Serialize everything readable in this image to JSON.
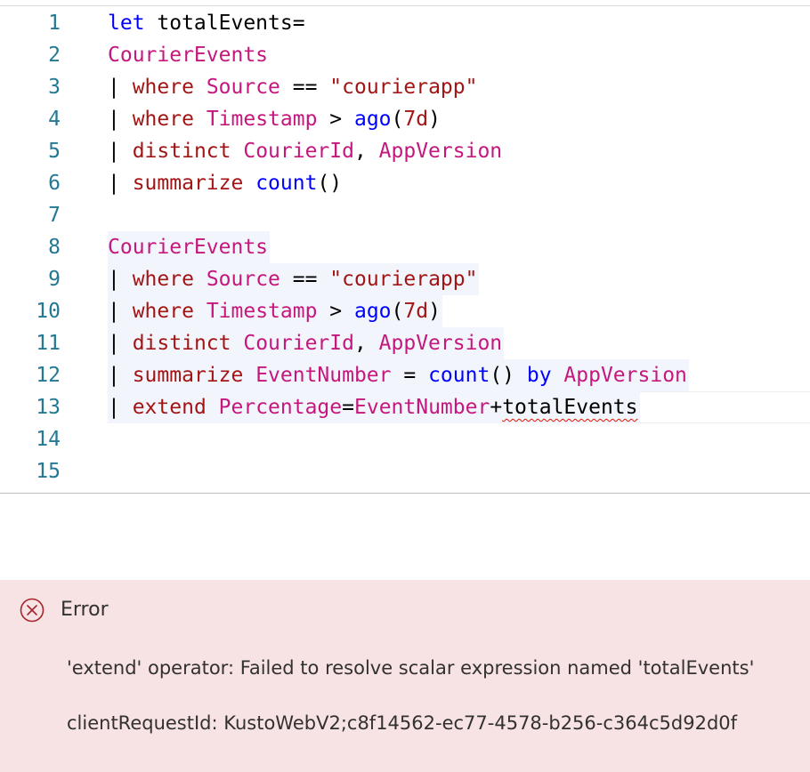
{
  "editor": {
    "lines": [
      {
        "num": "1",
        "tokens": [
          {
            "t": "let",
            "c": "kw"
          },
          {
            "t": " totalEvents=",
            "c": "pl"
          }
        ]
      },
      {
        "num": "2",
        "tokens": [
          {
            "t": "CourierEvents",
            "c": "tbl"
          }
        ]
      },
      {
        "num": "3",
        "tokens": [
          {
            "t": "| ",
            "c": "pl"
          },
          {
            "t": "where",
            "c": "op"
          },
          {
            "t": " ",
            "c": "pl"
          },
          {
            "t": "Source",
            "c": "col"
          },
          {
            "t": " == ",
            "c": "pl"
          },
          {
            "t": "\"courierapp\"",
            "c": "str"
          }
        ]
      },
      {
        "num": "4",
        "tokens": [
          {
            "t": "| ",
            "c": "pl"
          },
          {
            "t": "where",
            "c": "op"
          },
          {
            "t": " ",
            "c": "pl"
          },
          {
            "t": "Timestamp",
            "c": "col"
          },
          {
            "t": " > ",
            "c": "pl"
          },
          {
            "t": "ago",
            "c": "fn"
          },
          {
            "t": "(",
            "c": "pl"
          },
          {
            "t": "7d",
            "c": "op"
          },
          {
            "t": ")",
            "c": "pl"
          }
        ]
      },
      {
        "num": "5",
        "tokens": [
          {
            "t": "| ",
            "c": "pl"
          },
          {
            "t": "distinct",
            "c": "op"
          },
          {
            "t": " ",
            "c": "pl"
          },
          {
            "t": "CourierId",
            "c": "col"
          },
          {
            "t": ", ",
            "c": "pl"
          },
          {
            "t": "AppVersion",
            "c": "col"
          }
        ]
      },
      {
        "num": "6",
        "tokens": [
          {
            "t": "| ",
            "c": "pl"
          },
          {
            "t": "summarize",
            "c": "op"
          },
          {
            "t": " ",
            "c": "pl"
          },
          {
            "t": "count",
            "c": "fn"
          },
          {
            "t": "()",
            "c": "pl"
          }
        ]
      },
      {
        "num": "7",
        "tokens": []
      },
      {
        "num": "8",
        "tokens": [
          {
            "t": "CourierEvents",
            "c": "tbl"
          }
        ],
        "hl": true
      },
      {
        "num": "9",
        "tokens": [
          {
            "t": "| ",
            "c": "pl"
          },
          {
            "t": "where",
            "c": "op"
          },
          {
            "t": " ",
            "c": "pl"
          },
          {
            "t": "Source",
            "c": "col"
          },
          {
            "t": " == ",
            "c": "pl"
          },
          {
            "t": "\"courierapp\"",
            "c": "str"
          }
        ],
        "hl": true
      },
      {
        "num": "10",
        "tokens": [
          {
            "t": "| ",
            "c": "pl"
          },
          {
            "t": "where",
            "c": "op"
          },
          {
            "t": " ",
            "c": "pl"
          },
          {
            "t": "Timestamp",
            "c": "col"
          },
          {
            "t": " > ",
            "c": "pl"
          },
          {
            "t": "ago",
            "c": "fn"
          },
          {
            "t": "(",
            "c": "pl"
          },
          {
            "t": "7d",
            "c": "op"
          },
          {
            "t": ")",
            "c": "pl"
          }
        ],
        "hl": true
      },
      {
        "num": "11",
        "tokens": [
          {
            "t": "| ",
            "c": "pl"
          },
          {
            "t": "distinct",
            "c": "op"
          },
          {
            "t": " ",
            "c": "pl"
          },
          {
            "t": "CourierId",
            "c": "col"
          },
          {
            "t": ", ",
            "c": "pl"
          },
          {
            "t": "AppVersion",
            "c": "col"
          }
        ],
        "hl": true
      },
      {
        "num": "12",
        "tokens": [
          {
            "t": "| ",
            "c": "pl"
          },
          {
            "t": "summarize",
            "c": "op"
          },
          {
            "t": " ",
            "c": "pl"
          },
          {
            "t": "EventNumber",
            "c": "col"
          },
          {
            "t": " = ",
            "c": "pl"
          },
          {
            "t": "count",
            "c": "fn"
          },
          {
            "t": "() ",
            "c": "pl"
          },
          {
            "t": "by",
            "c": "kw"
          },
          {
            "t": " ",
            "c": "pl"
          },
          {
            "t": "AppVersion",
            "c": "col"
          }
        ],
        "hl": true
      },
      {
        "num": "13",
        "tokens": [
          {
            "t": "| ",
            "c": "pl"
          },
          {
            "t": "extend",
            "c": "op"
          },
          {
            "t": " ",
            "c": "pl"
          },
          {
            "t": "Percentage",
            "c": "col"
          },
          {
            "t": "=",
            "c": "pl"
          },
          {
            "t": "EventNumber",
            "c": "col"
          },
          {
            "t": "+",
            "c": "pl"
          },
          {
            "t": "totalEvents",
            "c": "pl",
            "err": true
          }
        ],
        "hl": true,
        "current": true
      },
      {
        "num": "14",
        "tokens": []
      },
      {
        "num": "15",
        "tokens": []
      }
    ]
  },
  "error": {
    "icon": "error-circle-x-icon",
    "title": "Error",
    "message": "'extend' operator: Failed to resolve scalar expression named 'totalEvents'",
    "request": "clientRequestId: KustoWebV2;c8f14562-ec77-4578-b256-c364c5d92d0f"
  },
  "colors": {
    "keyword": "#0000ff",
    "table": "#c5177d",
    "operator": "#a31515",
    "line_number": "#237893",
    "error_bg": "#f8e3e4",
    "error_icon": "#a4262c"
  }
}
